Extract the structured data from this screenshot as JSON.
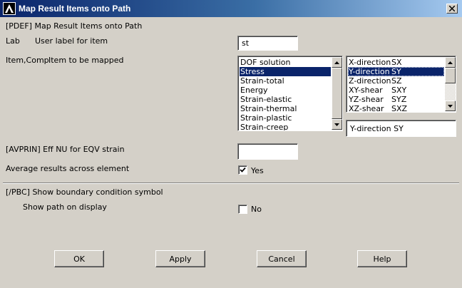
{
  "window": {
    "title": "Map Result Items onto Path"
  },
  "pdef": {
    "header": "[PDEF]  Map Result Items onto Path",
    "lab_key": "Lab",
    "lab_desc": "User label for item",
    "lab_value": "st",
    "item_key": "Item,Comp",
    "item_desc": "Item to be mapped",
    "items": [
      {
        "label": "DOF solution",
        "selected": false
      },
      {
        "label": "Stress",
        "selected": true
      },
      {
        "label": "Strain-total",
        "selected": false
      },
      {
        "label": "Energy",
        "selected": false
      },
      {
        "label": "Strain-elastic",
        "selected": false
      },
      {
        "label": "Strain-thermal",
        "selected": false
      },
      {
        "label": "Strain-plastic",
        "selected": false
      },
      {
        "label": "Strain-creep",
        "selected": false
      }
    ],
    "components": [
      {
        "name": "X-direction",
        "code": "SX",
        "selected": false
      },
      {
        "name": "Y-direction",
        "code": "SY",
        "selected": true
      },
      {
        "name": "Z-direction",
        "code": "SZ",
        "selected": false
      },
      {
        "name": "XY-shear",
        "code": "SXY",
        "selected": false
      },
      {
        "name": "YZ-shear",
        "code": "SYZ",
        "selected": false
      },
      {
        "name": "XZ-shear",
        "code": "SXZ",
        "selected": false
      }
    ],
    "component_selected_display": "Y-direction    SY"
  },
  "avprin": {
    "label": "[AVPRIN]  Eff NU for EQV strain",
    "value": ""
  },
  "average": {
    "label": "Average results across element",
    "checked": true,
    "checkbox_label": "Yes"
  },
  "pbc": {
    "header": "[/PBC]  Show boundary condition symbol",
    "show_path_label": "Show path on display",
    "checked": false,
    "checkbox_label": "No"
  },
  "buttons": {
    "ok": "OK",
    "apply": "Apply",
    "cancel": "Cancel",
    "help": "Help"
  },
  "icons": {
    "app_logo": "ansys-logo-icon",
    "close": "close-icon",
    "scroll_up": "scroll-up-arrow-icon",
    "scroll_down": "scroll-down-arrow-icon",
    "checkmark": "checkmark-icon"
  }
}
